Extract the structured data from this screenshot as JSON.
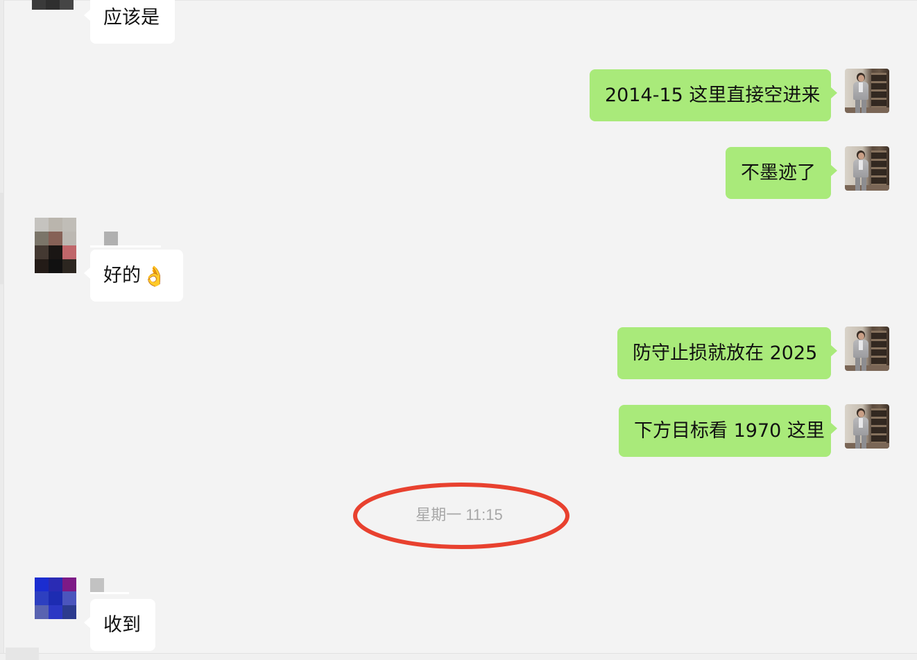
{
  "messages": [
    {
      "id": "m1",
      "side": "in",
      "text": "应该是"
    },
    {
      "id": "m2",
      "side": "out",
      "text": "2014-15 这里直接空进来"
    },
    {
      "id": "m3",
      "side": "out",
      "text": "不墨迹了"
    },
    {
      "id": "m4",
      "side": "in",
      "text": "好的",
      "emoji": "👌"
    },
    {
      "id": "m5",
      "side": "out",
      "text": "防守止损就放在 2025"
    },
    {
      "id": "m6",
      "side": "out",
      "text": "下方目标看 1970 这里"
    },
    {
      "id": "m7",
      "side": "in",
      "text": "收到"
    }
  ],
  "timestamp": "星期一 11:15",
  "colors": {
    "background": "#f3f3f3",
    "incoming_bubble": "#ffffff",
    "outgoing_bubble": "#a9ea7a",
    "timestamp_text": "#a7a7a7",
    "annotation_circle": "#e8412f"
  }
}
